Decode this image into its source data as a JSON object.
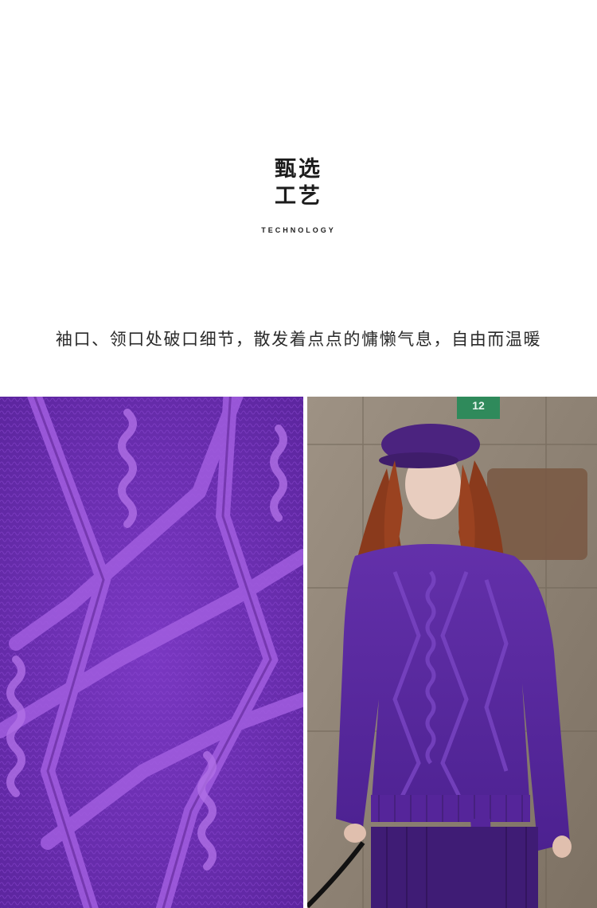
{
  "heading": {
    "line1": "甄选",
    "line2": "工艺",
    "subtitle": "TECHNOLOGY"
  },
  "description": "袖口、领口处破口细节，散发着点点的慵懒气息，自由而温暖",
  "photos": {
    "left": {
      "colors": {
        "base": "#6a2fb0",
        "highlight": "#a458e0",
        "shadow": "#4a1c86"
      }
    },
    "right": {
      "sign_number": "12",
      "colors": {
        "wall": "#8f8273",
        "sweater": "#5b2aa0",
        "beret": "#4b237f",
        "hair": "#8a3a1c",
        "skin": "#e8cdbf",
        "sign": "#2f8a5b"
      }
    }
  }
}
